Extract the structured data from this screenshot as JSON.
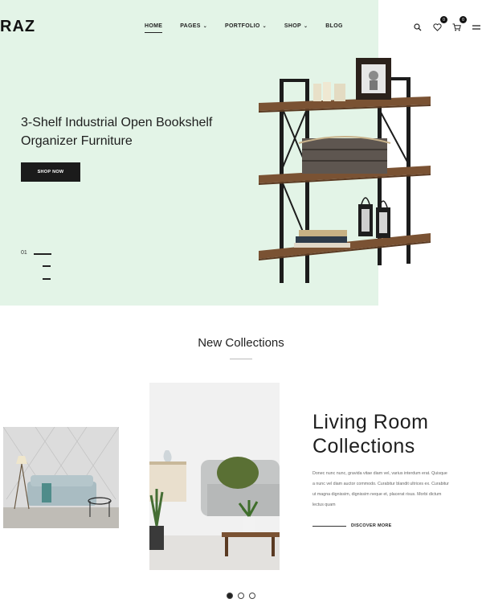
{
  "header": {
    "logo": "RAZ",
    "nav": [
      {
        "label": "HOME",
        "has_caret": false,
        "active": true
      },
      {
        "label": "PAGES",
        "has_caret": true,
        "active": false
      },
      {
        "label": "PORTFOLIO",
        "has_caret": true,
        "active": false
      },
      {
        "label": "SHOP",
        "has_caret": true,
        "active": false
      },
      {
        "label": "BLOG",
        "has_caret": false,
        "active": false
      }
    ],
    "icons": [
      "search-icon",
      "heart-icon",
      "cart-icon",
      "menu-icon"
    ],
    "wishlist_count": "0",
    "cart_count": "0"
  },
  "hero": {
    "title": "3-Shelf Industrial Open Bookshelf Organizer Furniture",
    "button": "SHOP NOW",
    "slide_number": "01",
    "bg_color": "#e3f4e7"
  },
  "collections": {
    "section_title": "New Collections",
    "title": "Living Room Collections",
    "description": "Donec nunc nunc, gravida vitae diam vel, varius interdum erat. Quisque a nunc vel diam auctor commodo. Curabitur blandit ultrices ex. Curabitur ut magna dignissim, dignissim neque et, placerat risus. Morbi dictum lectus quam",
    "link": "DISCOVER MORE",
    "active_dot": 0
  }
}
